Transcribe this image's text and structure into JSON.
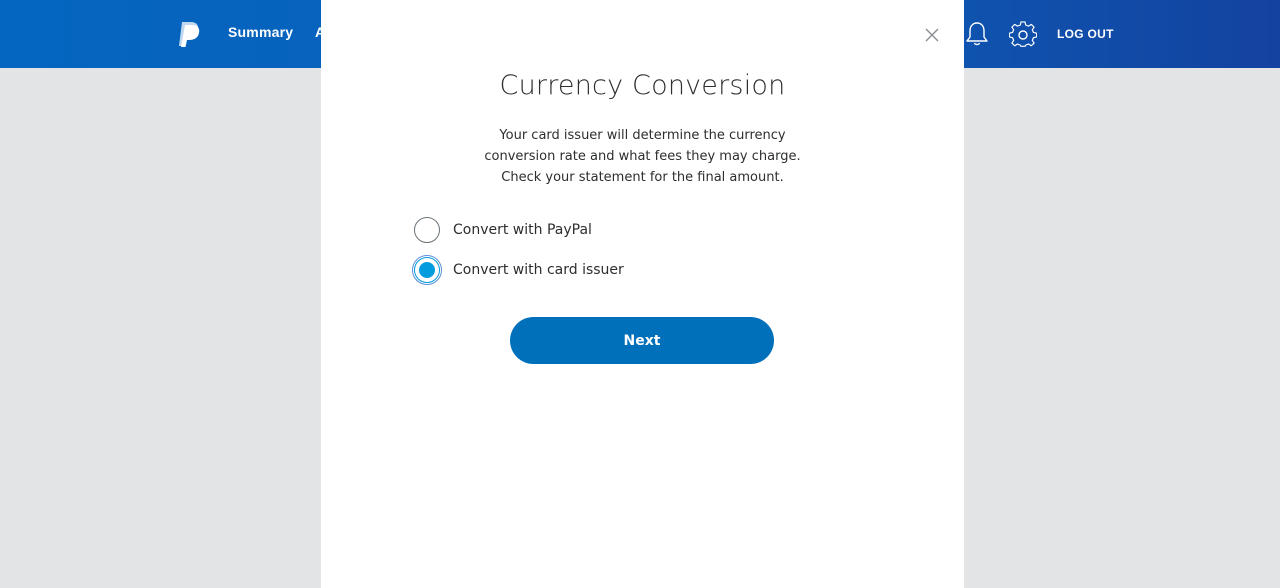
{
  "header": {
    "nav_summary": "Summary",
    "nav_partial": "A",
    "logout_label": "LOG OUT",
    "brand_color": "#0070ba",
    "icons": [
      "paypal-logo-icon",
      "bell-icon",
      "gear-icon"
    ]
  },
  "modal": {
    "title": "Currency Conversion",
    "description_lines": [
      "Your card issuer will determine the currency",
      "conversion rate and what fees they may charge.",
      "Check your statement for the final amount."
    ],
    "options": [
      {
        "label": "Convert with PayPal",
        "selected": false
      },
      {
        "label": "Convert with card issuer",
        "selected": true
      }
    ],
    "next_label": "Next",
    "close_icon": "close-icon"
  }
}
